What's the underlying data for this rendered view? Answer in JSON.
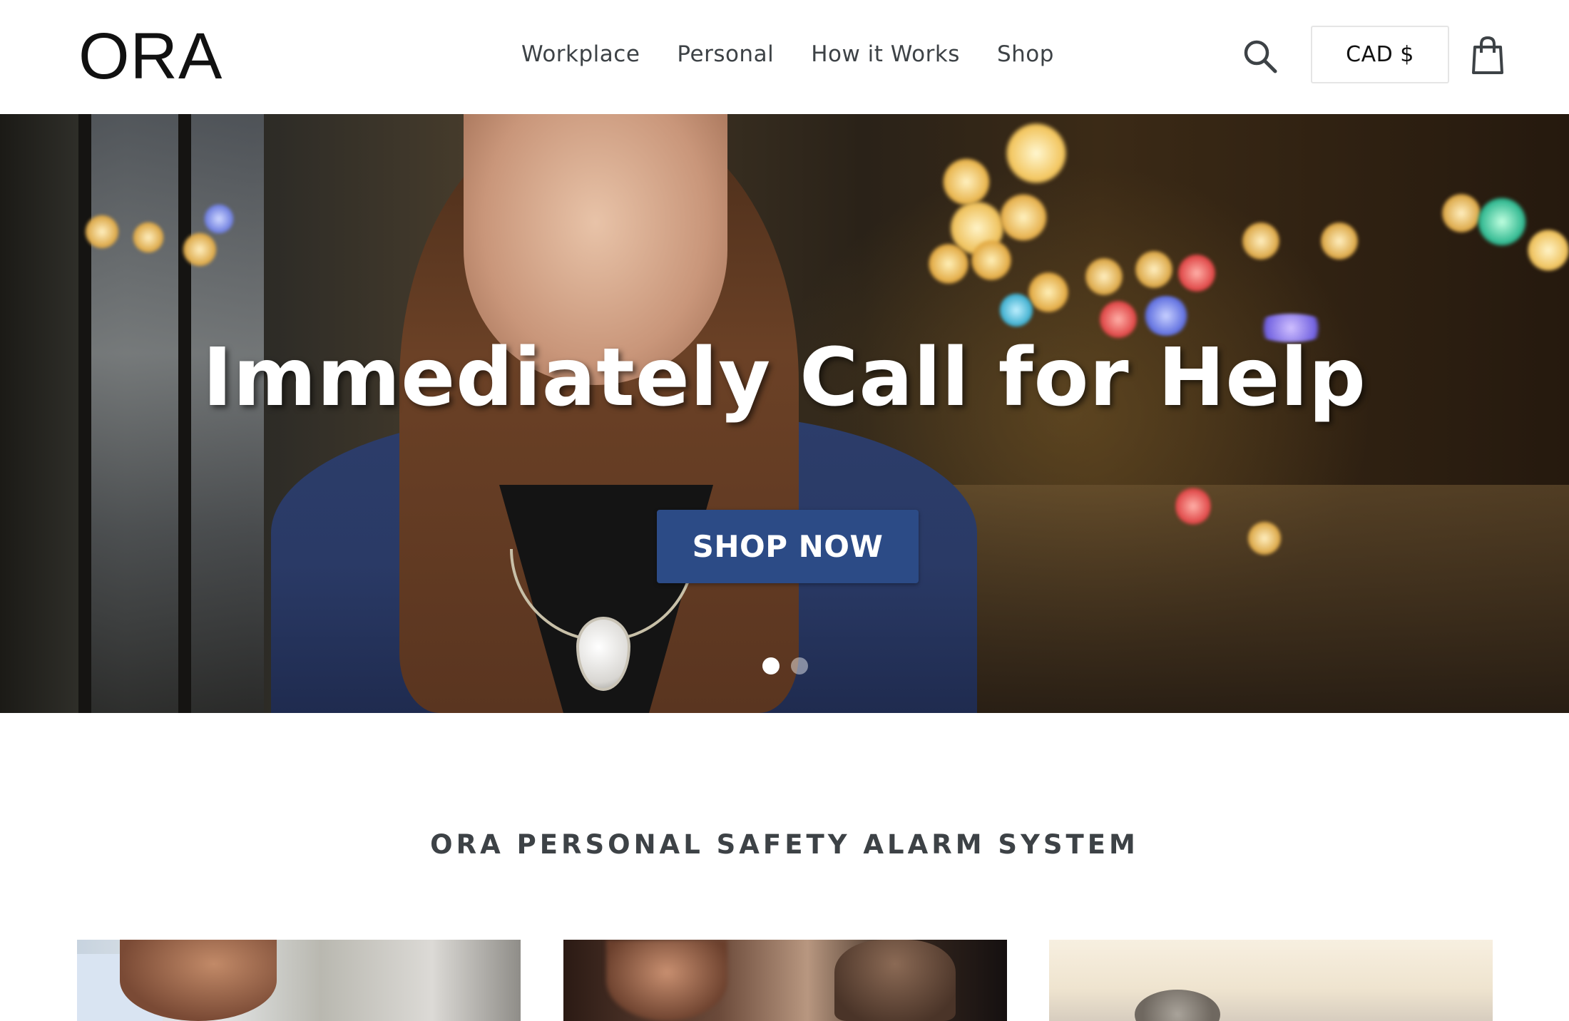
{
  "header": {
    "logo": "ORA",
    "nav": [
      "Workplace",
      "Personal",
      "How it Works",
      "Shop"
    ],
    "currency": "CAD $",
    "icons": {
      "search": "search-icon",
      "cart": "shopping-bag-icon"
    }
  },
  "hero": {
    "title": "Immediately Call for Help",
    "cta": "SHOP NOW",
    "slides": 2,
    "active_slide": 1
  },
  "section": {
    "title": "ORA PERSONAL SAFETY ALARM SYSTEM"
  },
  "colors": {
    "cta_background": "#2c4b86",
    "text_dark": "#3d4246"
  }
}
